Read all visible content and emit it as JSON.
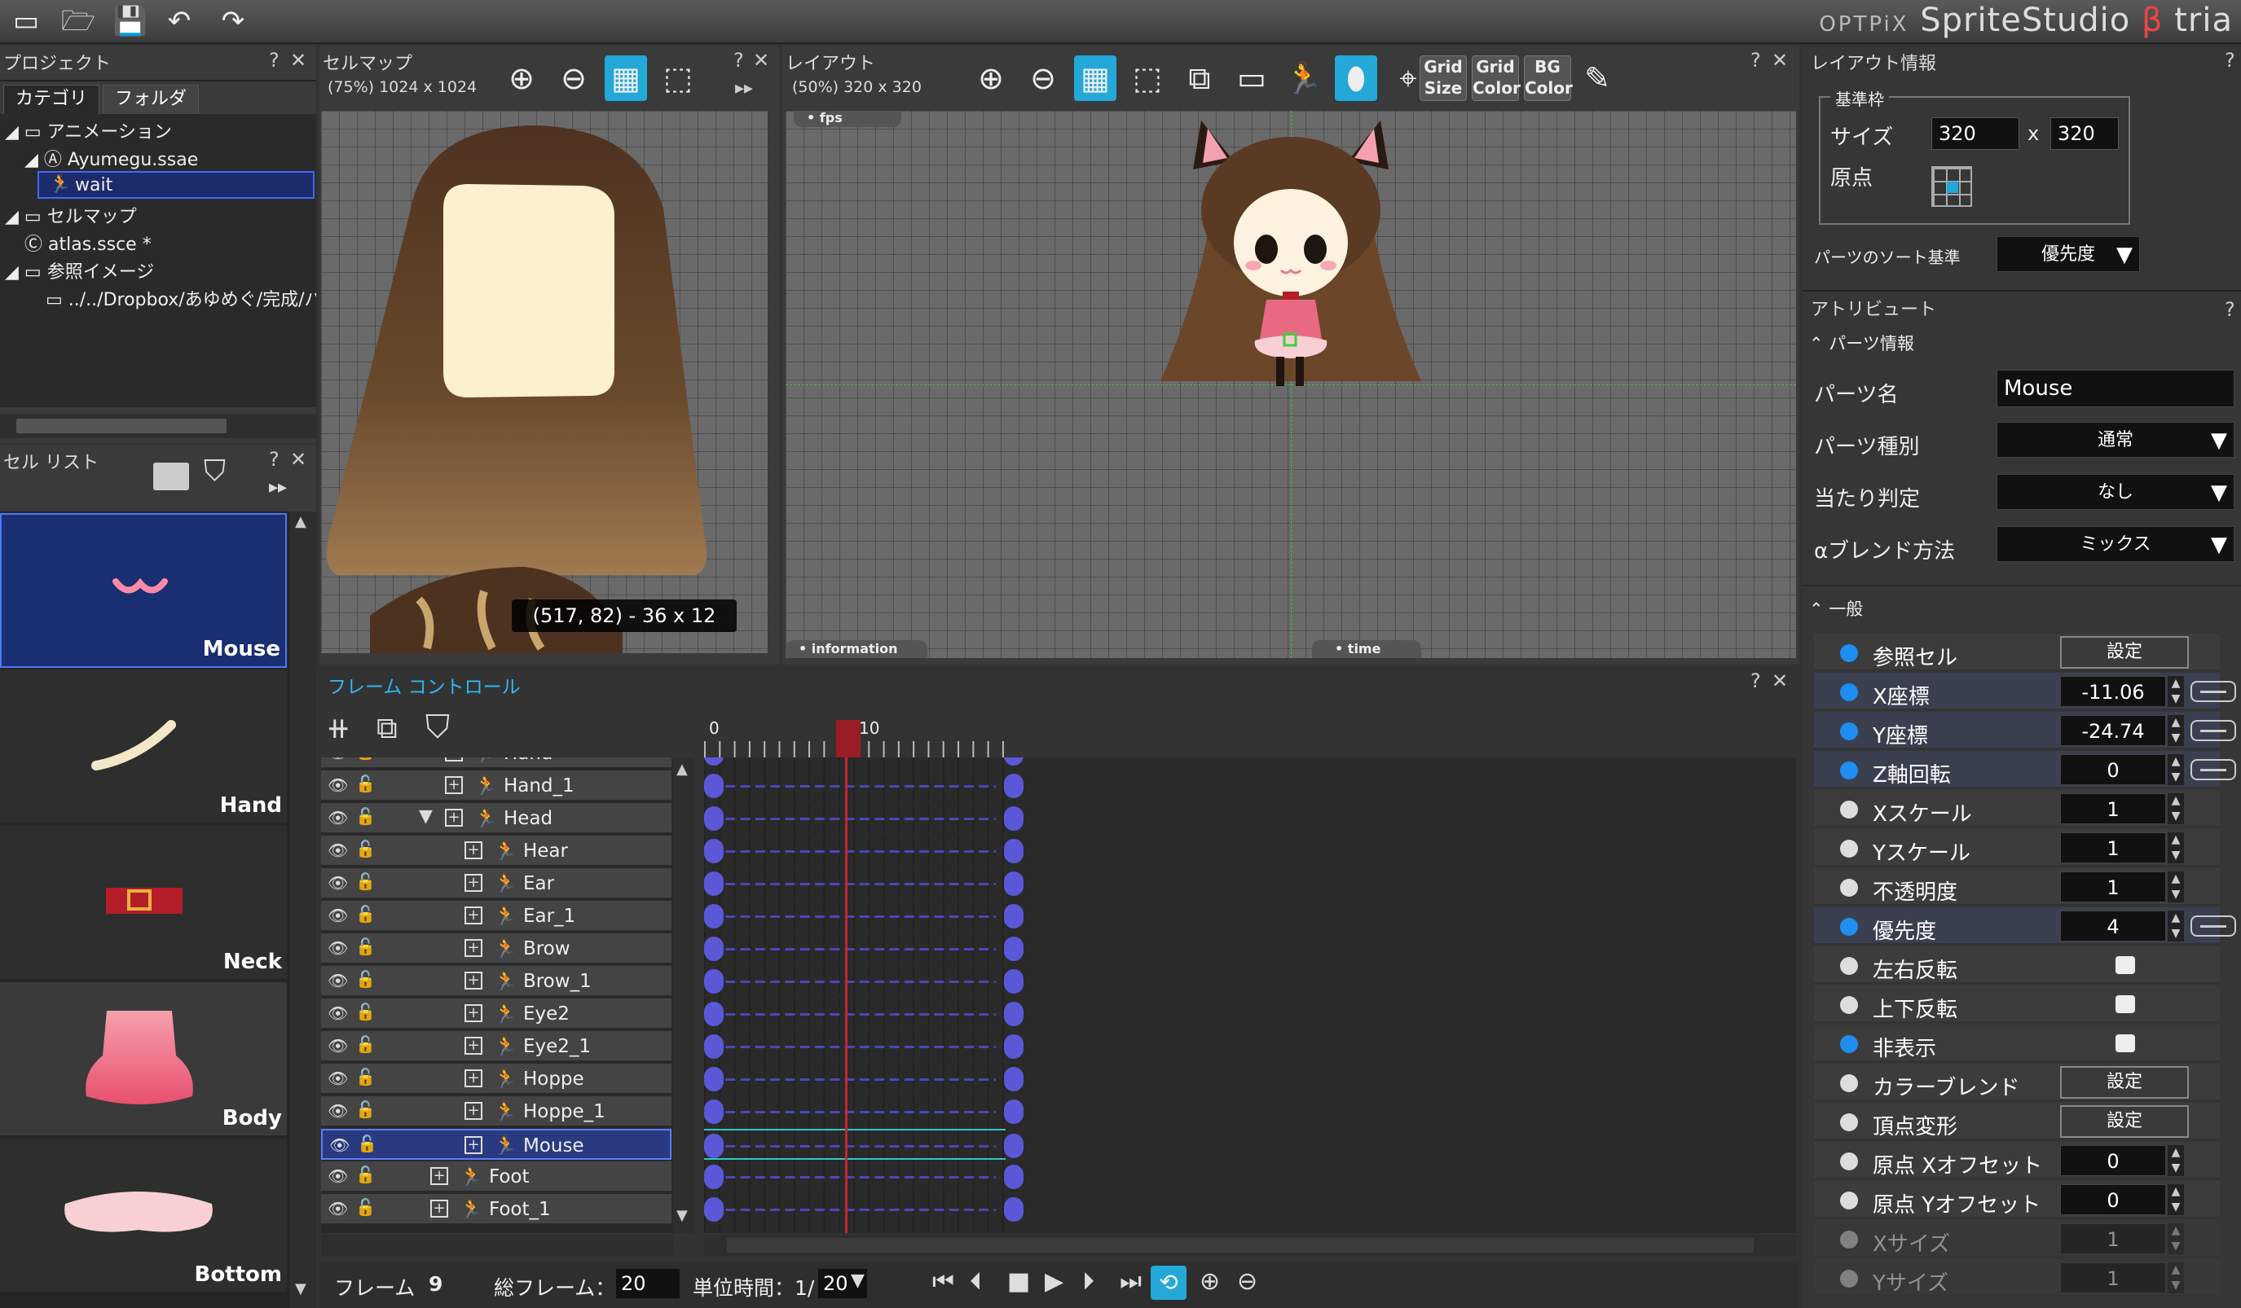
{
  "brand": {
    "prefix": "OPTPiX",
    "name": "SpriteStudio",
    "beta": "β",
    "suffix": "tria"
  },
  "project": {
    "title": "プロジェクト",
    "tabs": [
      "カテゴリ",
      "フォルダ"
    ],
    "tree": [
      {
        "label": "アニメーション"
      },
      {
        "label": "Ayumegu.ssae"
      },
      {
        "label": "wait"
      },
      {
        "label": "セルマップ"
      },
      {
        "label": "atlas.ssce *"
      },
      {
        "label": "参照イメージ"
      },
      {
        "label": "../../Dropbox/あゆめぐ/完成/パ"
      }
    ]
  },
  "cellmap": {
    "title": "セルマップ",
    "info": "(75%) 1024 x 1024",
    "tooltip": "(517, 82) - 36 x 12"
  },
  "layout": {
    "title": "レイアウト",
    "info": "(50%) 320 x 320",
    "tags": {
      "fps": "fps",
      "information": "information",
      "time": "time"
    },
    "buttons": {
      "grid_size": [
        "Grid",
        "Size"
      ],
      "grid_color": [
        "Grid",
        "Color"
      ],
      "bg_color": [
        "BG",
        "Color"
      ]
    }
  },
  "cell_list": {
    "title": "セル リスト",
    "cells": [
      "Mouse",
      "Hand",
      "Neck",
      "Body",
      "Bottom"
    ]
  },
  "frame_control": {
    "title": "フレーム コントロール",
    "ruler": {
      "start": "0",
      "mark": "10"
    },
    "current_frame_index": 9,
    "key_frames": [
      0,
      20
    ],
    "rows": [
      {
        "name": "Hand"
      },
      {
        "name": "Hand_1"
      },
      {
        "name": "Head"
      },
      {
        "name": "Hear"
      },
      {
        "name": "Ear"
      },
      {
        "name": "Ear_1"
      },
      {
        "name": "Brow"
      },
      {
        "name": "Brow_1"
      },
      {
        "name": "Eye2"
      },
      {
        "name": "Eye2_1"
      },
      {
        "name": "Hoppe"
      },
      {
        "name": "Hoppe_1"
      },
      {
        "name": "Mouse"
      },
      {
        "name": "Foot"
      },
      {
        "name": "Foot_1"
      }
    ],
    "footer": {
      "frame_label": "フレーム",
      "frame_value": "9",
      "total_label": "総フレーム：",
      "total_value": "20",
      "unit_label": "単位時間：1/",
      "unit_value": "20"
    }
  },
  "layout_info": {
    "title": "レイアウト情報",
    "group": "基準枠",
    "size_label": "サイズ",
    "width": "320",
    "x": "x",
    "height": "320",
    "origin_label": "原点",
    "sort_label": "パーツのソート基準",
    "sort_value": "優先度"
  },
  "attributes": {
    "title": "アトリビュート",
    "parts_info": "パーツ情報",
    "part_name_label": "パーツ名",
    "part_name": "Mouse",
    "part_type_label": "パーツ種別",
    "part_type": "通常",
    "hit_label": "当たり判定",
    "hit": "なし",
    "blend_label": "αブレンド方法",
    "blend": "ミックス",
    "general": "一般",
    "rows": [
      {
        "label": "参照セル",
        "button": "設定"
      },
      {
        "label": "X座標",
        "value": "-11.06"
      },
      {
        "label": "Y座標",
        "value": "-24.74"
      },
      {
        "label": "Z軸回転",
        "value": "0"
      },
      {
        "label": "Xスケール",
        "value": "1"
      },
      {
        "label": "Yスケール",
        "value": "1"
      },
      {
        "label": "不透明度",
        "value": "1"
      },
      {
        "label": "優先度",
        "value": "4"
      },
      {
        "label": "左右反転"
      },
      {
        "label": "上下反転"
      },
      {
        "label": "非表示"
      },
      {
        "label": "カラーブレンド",
        "button": "設定"
      },
      {
        "label": "頂点変形",
        "button": "設定"
      },
      {
        "label": "原点 Xオフセット",
        "value": "0"
      },
      {
        "label": "原点 Yオフセット",
        "value": "0"
      },
      {
        "label": "Xサイズ",
        "value": "1"
      },
      {
        "label": "Yサイズ",
        "value": "1"
      }
    ]
  }
}
